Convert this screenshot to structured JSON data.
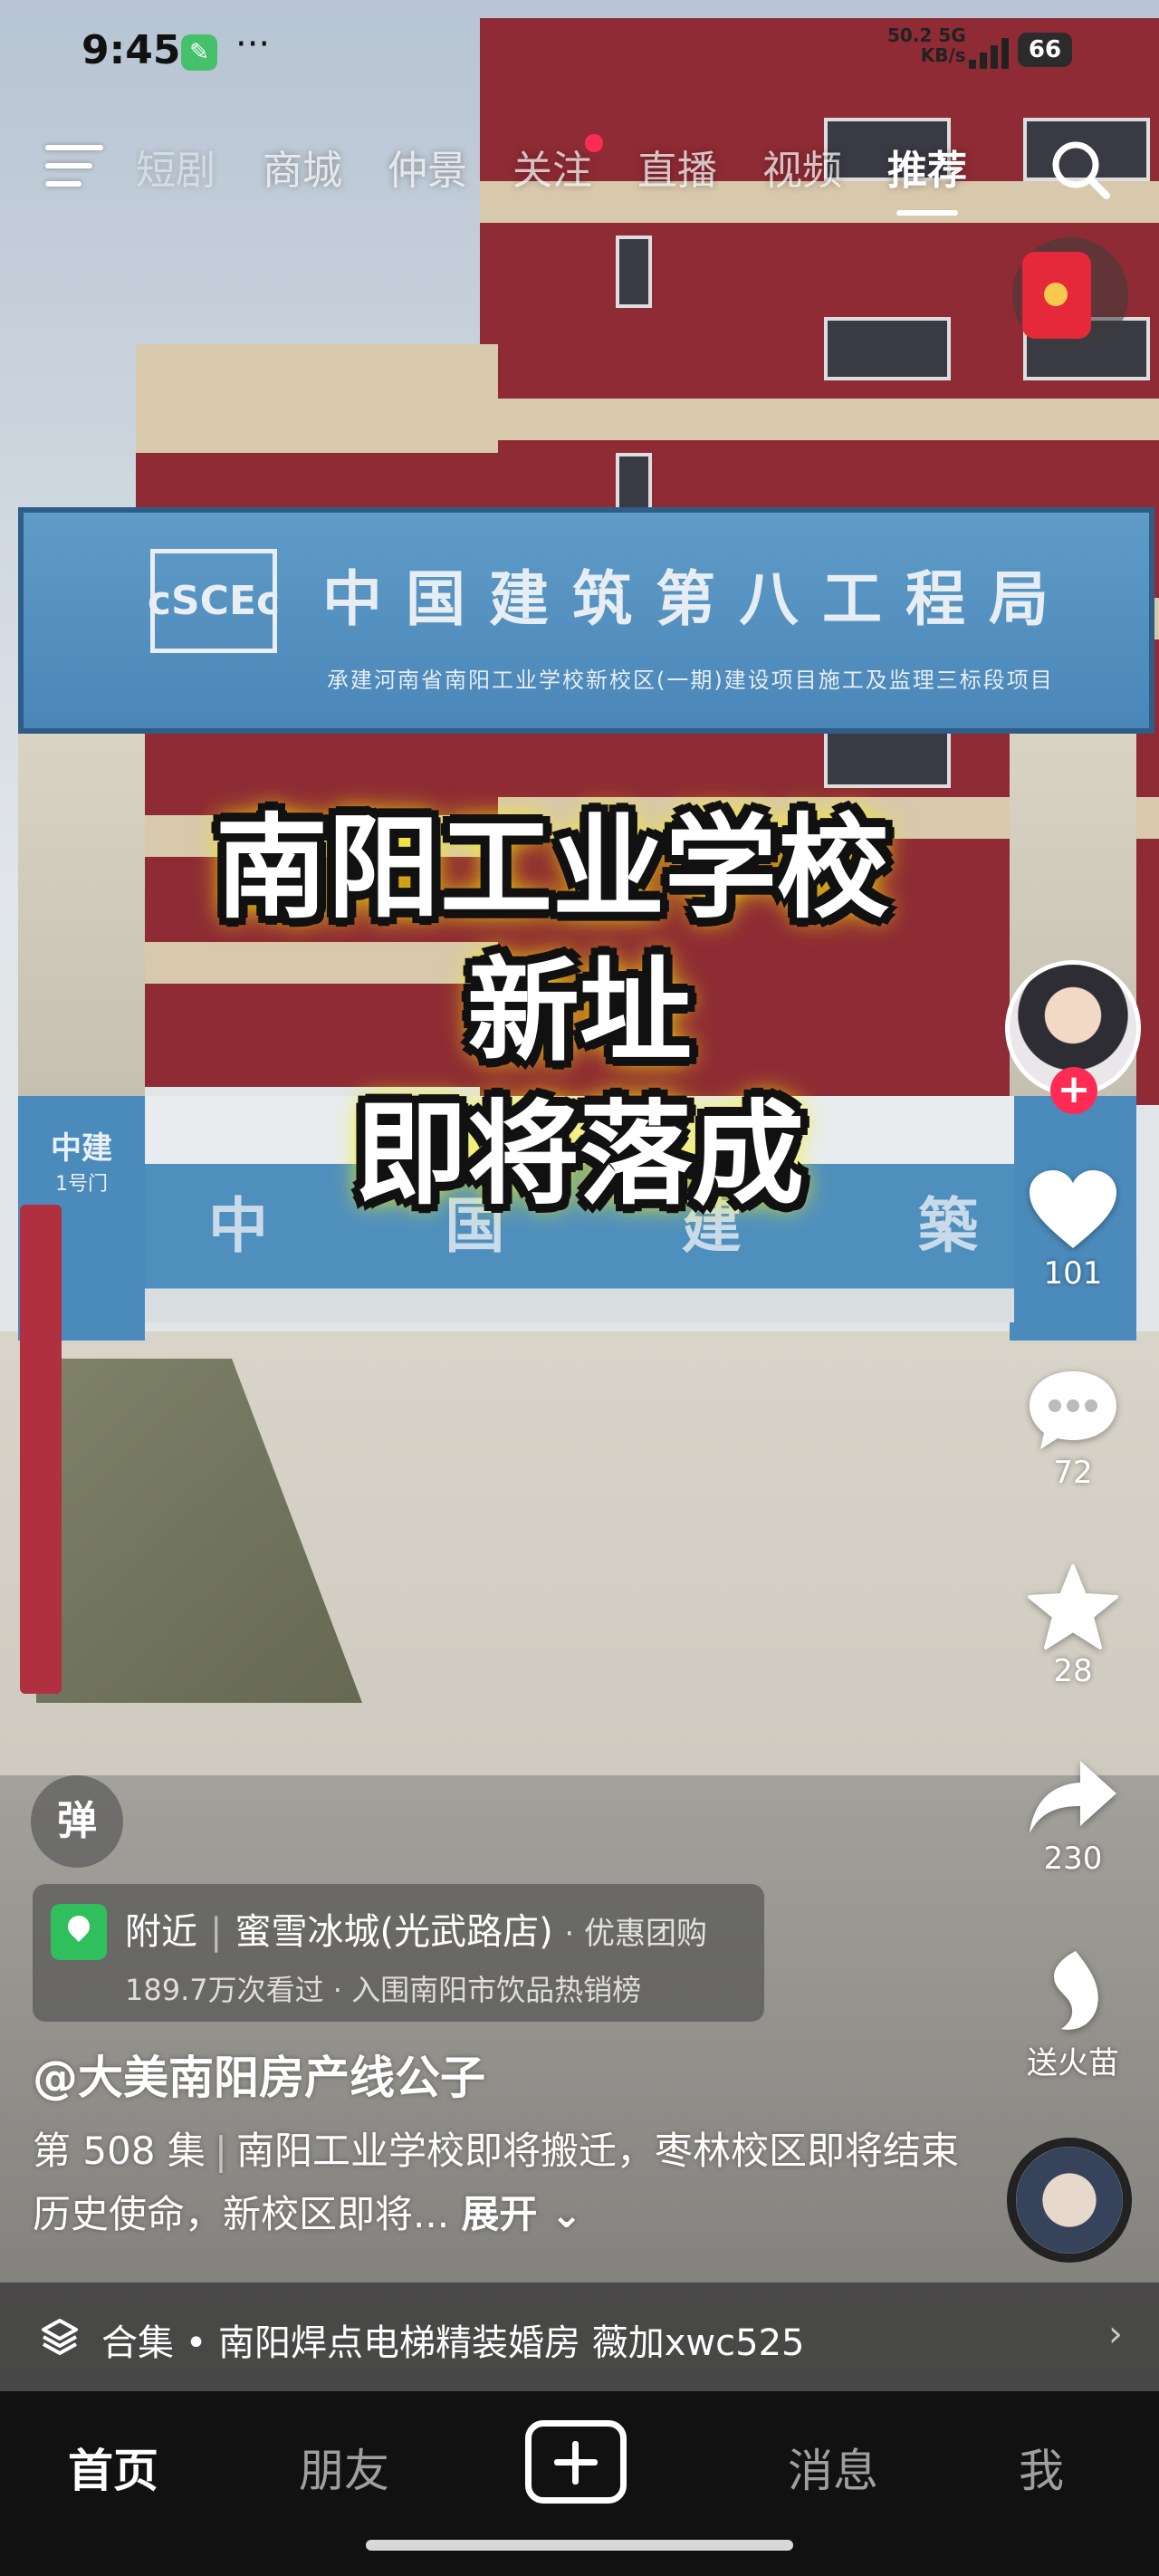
{
  "status_bar": {
    "time": "9:45",
    "app_indicator_icon": "wrench-icon",
    "more_dots": "···",
    "network_speed": "50.2",
    "network_unit": "KB/s",
    "network_type": "5G",
    "battery": "66"
  },
  "top_nav": {
    "tabs": [
      {
        "label": "短剧",
        "active": false
      },
      {
        "label": "商城",
        "active": false
      },
      {
        "label": "仲景",
        "active": false
      },
      {
        "label": "关注",
        "active": false,
        "dot": true
      },
      {
        "label": "直播",
        "active": false
      },
      {
        "label": "视频",
        "active": false
      },
      {
        "label": "推荐",
        "active": true
      }
    ],
    "menu_icon": "hamburger-menu-icon",
    "search_icon": "search-icon"
  },
  "red_packet_icon": "red-packet-icon",
  "video": {
    "gate_sign_title": "中国建筑第八工程局",
    "gate_sign_subtitle": "承建河南省南阳工业学校新校区(一期)建设项目施工及监理三标段项目",
    "gate_logo_text": "cSCEc",
    "pillar_text": "中建",
    "pillar_subtext": "1号门",
    "fence_chars": [
      "中",
      "国",
      "建",
      "築"
    ],
    "caption_lines": [
      "南阳工业学校",
      "新址",
      "即将落成"
    ]
  },
  "actions": {
    "like_count": "101",
    "comment_count": "72",
    "favorite_count": "28",
    "share_count": "230",
    "flame_label": "送火苗"
  },
  "danmaku_label": "弹",
  "location": {
    "nearby": "附近",
    "store": "蜜雪冰城(光武路店)",
    "tag": "· 优惠团购",
    "views": "189.7万次看过",
    "ranking": "· 入围南阳市饮品热销榜"
  },
  "author": "@大美南阳房产线公子",
  "description": {
    "episode": "第 508 集",
    "text": "南阳工业学校即将搬迁，枣林校区即将结束历史使命，新校区即将...",
    "expand": "展开"
  },
  "collection": {
    "label": "合集 • 南阳焊点电梯精装婚房 薇加xwc525"
  },
  "bottom_tabs": [
    {
      "label": "首页",
      "active": true
    },
    {
      "label": "朋友",
      "active": false
    },
    {
      "label": "消息",
      "active": false
    },
    {
      "label": "我",
      "active": false
    }
  ],
  "colors": {
    "accent_red": "#fe2c55",
    "pin_green": "#2fbf5d",
    "caption_glow": "#fff200"
  }
}
